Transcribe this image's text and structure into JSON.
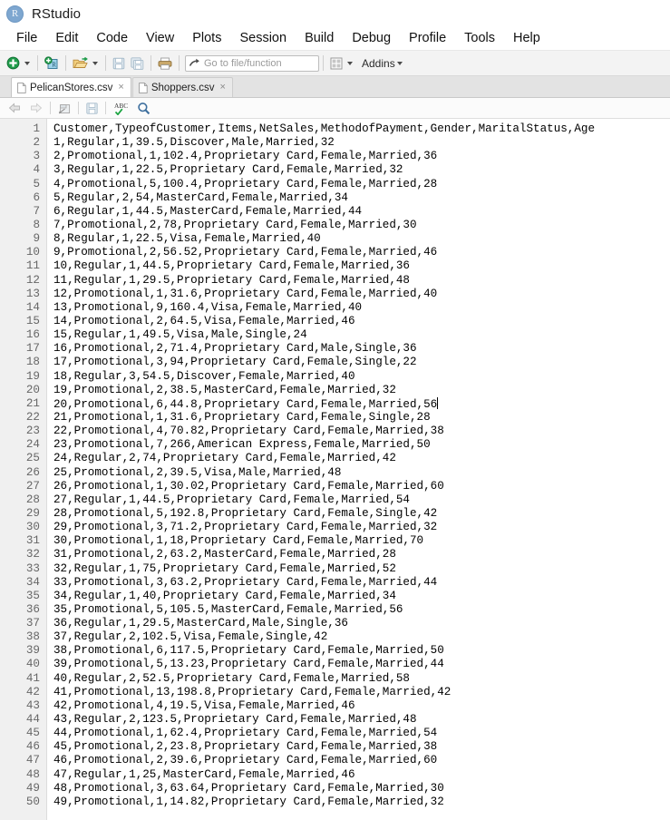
{
  "app": {
    "logo_letter": "R",
    "title": "RStudio"
  },
  "menubar": {
    "items": [
      {
        "label": "File"
      },
      {
        "label": "Edit"
      },
      {
        "label": "Code"
      },
      {
        "label": "View"
      },
      {
        "label": "Plots"
      },
      {
        "label": "Session"
      },
      {
        "label": "Build"
      },
      {
        "label": "Debug"
      },
      {
        "label": "Profile"
      },
      {
        "label": "Tools"
      },
      {
        "label": "Help"
      }
    ]
  },
  "toolbar": {
    "new_file_icon": "new-file-plus-icon",
    "new_project_icon": "new-project-icon",
    "open_file_icon": "open-folder-icon",
    "save_icon": "save-icon",
    "save_all_icon": "save-all-icon",
    "print_icon": "print-icon",
    "goto_icon": "goto-arrow-icon",
    "goto_placeholder": "Go to file/function",
    "panes_icon": "workspace-panes-icon",
    "addins_label": "Addins"
  },
  "tabs": {
    "items": [
      {
        "label": "PelicanStores.csv",
        "active": true,
        "close": "×"
      },
      {
        "label": "Shoppers.csv",
        "active": false,
        "close": "×"
      }
    ]
  },
  "editor_toolbar": {
    "back_icon": "back-arrow-icon",
    "forward_icon": "forward-arrow-icon",
    "source_on_save_icon": "show-in-new-window-icon",
    "save_icon": "save-icon",
    "spellcheck_icon": "spellcheck-abc-icon",
    "spellcheck_label": "ABC",
    "find_icon": "find-magnifier-icon"
  },
  "editor": {
    "cursor_line": 21,
    "lines": [
      "Customer,TypeofCustomer,Items,NetSales,MethodofPayment,Gender,MaritalStatus,Age",
      "1,Regular,1,39.5,Discover,Male,Married,32",
      "2,Promotional,1,102.4,Proprietary Card,Female,Married,36",
      "3,Regular,1,22.5,Proprietary Card,Female,Married,32",
      "4,Promotional,5,100.4,Proprietary Card,Female,Married,28",
      "5,Regular,2,54,MasterCard,Female,Married,34",
      "6,Regular,1,44.5,MasterCard,Female,Married,44",
      "7,Promotional,2,78,Proprietary Card,Female,Married,30",
      "8,Regular,1,22.5,Visa,Female,Married,40",
      "9,Promotional,2,56.52,Proprietary Card,Female,Married,46",
      "10,Regular,1,44.5,Proprietary Card,Female,Married,36",
      "11,Regular,1,29.5,Proprietary Card,Female,Married,48",
      "12,Promotional,1,31.6,Proprietary Card,Female,Married,40",
      "13,Promotional,9,160.4,Visa,Female,Married,40",
      "14,Promotional,2,64.5,Visa,Female,Married,46",
      "15,Regular,1,49.5,Visa,Male,Single,24",
      "16,Promotional,2,71.4,Proprietary Card,Male,Single,36",
      "17,Promotional,3,94,Proprietary Card,Female,Single,22",
      "18,Regular,3,54.5,Discover,Female,Married,40",
      "19,Promotional,2,38.5,MasterCard,Female,Married,32",
      "20,Promotional,6,44.8,Proprietary Card,Female,Married,56",
      "21,Promotional,1,31.6,Proprietary Card,Female,Single,28",
      "22,Promotional,4,70.82,Proprietary Card,Female,Married,38",
      "23,Promotional,7,266,American Express,Female,Married,50",
      "24,Regular,2,74,Proprietary Card,Female,Married,42",
      "25,Promotional,2,39.5,Visa,Male,Married,48",
      "26,Promotional,1,30.02,Proprietary Card,Female,Married,60",
      "27,Regular,1,44.5,Proprietary Card,Female,Married,54",
      "28,Promotional,5,192.8,Proprietary Card,Female,Single,42",
      "29,Promotional,3,71.2,Proprietary Card,Female,Married,32",
      "30,Promotional,1,18,Proprietary Card,Female,Married,70",
      "31,Promotional,2,63.2,MasterCard,Female,Married,28",
      "32,Regular,1,75,Proprietary Card,Female,Married,52",
      "33,Promotional,3,63.2,Proprietary Card,Female,Married,44",
      "34,Regular,1,40,Proprietary Card,Female,Married,34",
      "35,Promotional,5,105.5,MasterCard,Female,Married,56",
      "36,Regular,1,29.5,MasterCard,Male,Single,36",
      "37,Regular,2,102.5,Visa,Female,Single,42",
      "38,Promotional,6,117.5,Proprietary Card,Female,Married,50",
      "39,Promotional,5,13.23,Proprietary Card,Female,Married,44",
      "40,Regular,2,52.5,Proprietary Card,Female,Married,58",
      "41,Promotional,13,198.8,Proprietary Card,Female,Married,42",
      "42,Promotional,4,19.5,Visa,Female,Married,46",
      "43,Regular,2,123.5,Proprietary Card,Female,Married,48",
      "44,Promotional,1,62.4,Proprietary Card,Female,Married,54",
      "45,Promotional,2,23.8,Proprietary Card,Female,Married,38",
      "46,Promotional,2,39.6,Proprietary Card,Female,Married,60",
      "47,Regular,1,25,MasterCard,Female,Married,46",
      "48,Promotional,3,63.64,Proprietary Card,Female,Married,30",
      "49,Promotional,1,14.82,Proprietary Card,Female,Married,32"
    ]
  },
  "colors": {
    "logo_blue": "#7ea7d0",
    "toolbar_bg": "#f3f3f3",
    "gutter_bg": "#f0f0f0",
    "gutter_text": "#666666",
    "code_text": "#000000",
    "tabstrip_bg": "#e3e3e3"
  }
}
